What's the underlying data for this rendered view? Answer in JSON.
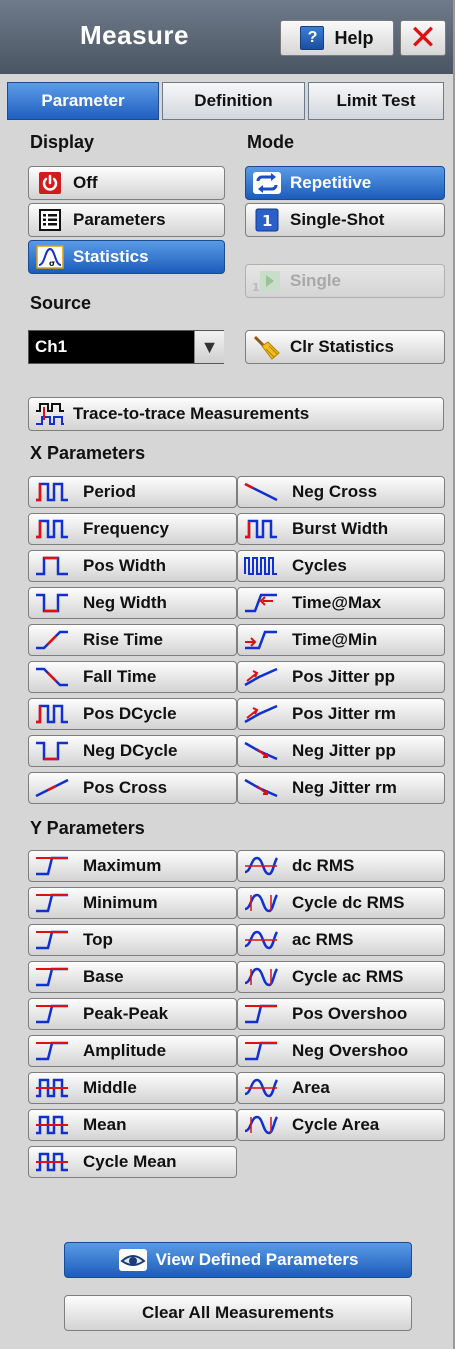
{
  "window": {
    "title": "Measure",
    "help_label": "Help"
  },
  "tabs": [
    {
      "label": "Parameter",
      "active": true
    },
    {
      "label": "Definition",
      "active": false
    },
    {
      "label": "Limit Test",
      "active": false
    }
  ],
  "display": {
    "label": "Display",
    "options": [
      {
        "label": "Off",
        "icon": "power-icon"
      },
      {
        "label": "Parameters",
        "icon": "list-icon"
      },
      {
        "label": "Statistics",
        "icon": "statistics-icon",
        "selected": true
      }
    ]
  },
  "mode": {
    "label": "Mode",
    "options": [
      {
        "label": "Repetitive",
        "icon": "repeat-icon",
        "selected": true
      },
      {
        "label": "Single-Shot",
        "icon": "single-shot-icon"
      }
    ],
    "single_label": "Single"
  },
  "source": {
    "label": "Source",
    "value": "Ch1"
  },
  "clear_statistics_label": "Clr Statistics",
  "trace_to_trace_label": "Trace-to-trace Measurements",
  "x_parameters": {
    "label": "X Parameters",
    "left": [
      "Period",
      "Frequency",
      "Pos Width",
      "Neg Width",
      "Rise Time",
      "Fall Time",
      "Pos DCycle",
      "Neg DCycle",
      "Pos Cross"
    ],
    "right": [
      "Neg Cross",
      "Burst Width",
      "Cycles",
      "Time@Max",
      "Time@Min",
      "Pos Jitter pp",
      "Pos Jitter rm",
      "Neg Jitter pp",
      "Neg Jitter rm"
    ]
  },
  "y_parameters": {
    "label": "Y Parameters",
    "left": [
      "Maximum",
      "Minimum",
      "Top",
      "Base",
      "Peak-Peak",
      "Amplitude",
      "Middle",
      "Mean",
      "Cycle Mean"
    ],
    "right": [
      "dc RMS",
      "Cycle dc RMS",
      "ac RMS",
      "Cycle ac RMS",
      "Pos Overshoo",
      "Neg Overshoo",
      "Area",
      "Cycle Area"
    ]
  },
  "view_defined_label": "View Defined Parameters",
  "clear_all_label": "Clear All Measurements",
  "colors": {
    "accent": "#1c5cbb",
    "waveform_blue": "#1030d0",
    "waveform_red": "#e01010"
  }
}
